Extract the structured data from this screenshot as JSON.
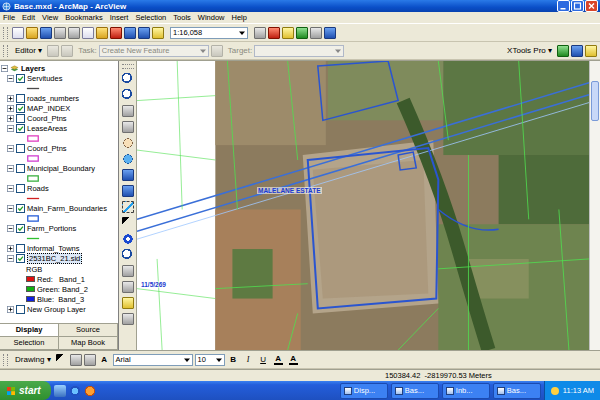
{
  "window": {
    "title": "Base.mxd - ArcMap - ArcView"
  },
  "menu": [
    "File",
    "Edit",
    "View",
    "Bookmarks",
    "Insert",
    "Selection",
    "Tools",
    "Window",
    "Help"
  ],
  "standard_toolbar": {
    "scale": "1:16,058"
  },
  "editor_toolbar": {
    "editor": "Editor ▾",
    "task_label": "Task:",
    "task": "Create New Feature",
    "target_label": "Target:",
    "xtools": "XTools Pro ▾",
    "disabled": true
  },
  "toc": {
    "root": "Layers",
    "layers": [
      {
        "name": "Servitudes",
        "checked": true,
        "expanded": true,
        "selected": false,
        "symbol": "line",
        "color": "#4a4a4a"
      },
      {
        "name": "roads_numbers",
        "checked": false,
        "expanded": false,
        "selected": false
      },
      {
        "name": "MAP_INDEX",
        "checked": true,
        "expanded": false,
        "selected": false
      },
      {
        "name": "Coord_Ptns",
        "checked": false,
        "expanded": false,
        "selected": false
      },
      {
        "name": "LeaseAreas",
        "checked": true,
        "expanded": true,
        "selected": false,
        "symbol": "fill",
        "color": "#e040c0"
      },
      {
        "name": "Coord_Ptns",
        "checked": false,
        "expanded": true,
        "selected": false,
        "symbol": "fill",
        "color": "#d040d0"
      },
      {
        "name": "Municipal_Boundary",
        "checked": false,
        "expanded": true,
        "selected": false,
        "symbol": "fill",
        "color": "#3cb043"
      },
      {
        "name": "Roads",
        "checked": false,
        "expanded": true,
        "selected": false,
        "symbol": "line",
        "color": "#d02020"
      },
      {
        "name": "Main_Farm_Boundaries",
        "checked": true,
        "expanded": true,
        "selected": false,
        "symbol": "fill",
        "color": "#2a5fd8"
      },
      {
        "name": "Farm_Portions",
        "checked": true,
        "expanded": true,
        "selected": false,
        "symbol": "line",
        "color": "#30c030"
      },
      {
        "name": "Informal_Towns",
        "checked": false,
        "expanded": false,
        "selected": false
      },
      {
        "name": "2531BC_21.sid",
        "checked": true,
        "expanded": true,
        "selected": true
      },
      {
        "name": "New Group Layer",
        "checked": false,
        "expanded": false,
        "selected": false
      }
    ],
    "raster": {
      "label": "RGB",
      "bands": [
        {
          "name": "Red:   Band_1",
          "color": "#e01010"
        },
        {
          "name": "Green: Band_2",
          "color": "#10b010"
        },
        {
          "name": "Blue:  Band_3",
          "color": "#1020e0"
        }
      ]
    },
    "tabs": [
      {
        "label": "Display",
        "selected": true
      },
      {
        "label": "Source",
        "selected": false
      },
      {
        "label": "Selection",
        "selected": false
      },
      {
        "label": "Map Book",
        "selected": false
      }
    ]
  },
  "map": {
    "labels": [
      "MALELANE ESTATE",
      "11/5/269"
    ]
  },
  "drawing_toolbar": {
    "drawing": "Drawing ▾",
    "text_tool": "A",
    "font": "Arial",
    "size": "10",
    "styles": [
      "B",
      "I",
      "U"
    ],
    "colors": [
      {
        "glyph": "A",
        "color": "#000000"
      },
      {
        "glyph": "A",
        "color": "#000000"
      }
    ]
  },
  "status_bar": {
    "coords": "150384.42  -2819970.53 Meters"
  },
  "taskbar": {
    "start": "start",
    "tasks": [
      "Disp...",
      "Bas...",
      "Inb...",
      "Bas..."
    ],
    "clock": "11:13 AM"
  }
}
